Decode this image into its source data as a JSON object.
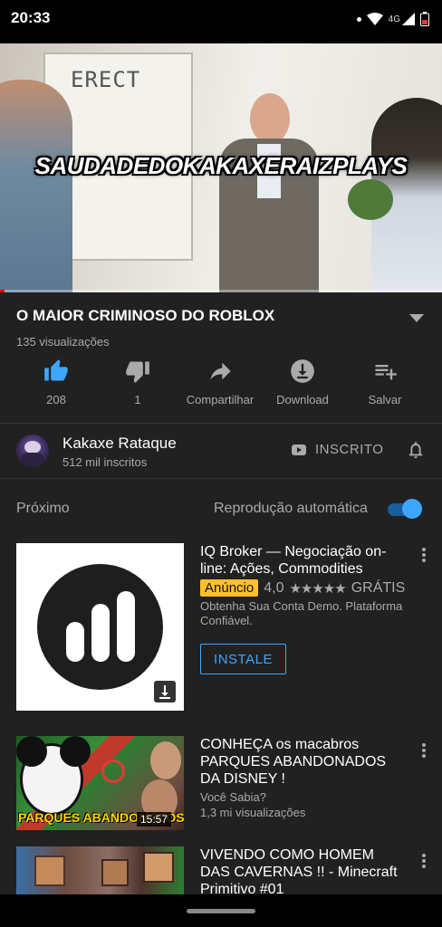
{
  "status_bar": {
    "time": "20:33",
    "network": "4G"
  },
  "player": {
    "overlay_text": "SAUDADEDOKAKAXERAIZPLAYS",
    "whiteboard_text": "ERECT",
    "progress": 0.01
  },
  "video_info": {
    "title": "O MAIOR CRIMINOSO DO ROBLOX",
    "views": "135 visualizações"
  },
  "actions": {
    "like_count": "208",
    "dislike_count": "1",
    "share_label": "Compartilhar",
    "download_label": "Download",
    "save_label": "Salvar"
  },
  "channel": {
    "name": "Kakaxe Rataque",
    "subscribers": "512 mil inscritos",
    "subscribe_state": "INSCRITO"
  },
  "up_next": {
    "label": "Próximo",
    "autoplay_label": "Reprodução automática",
    "autoplay_on": true
  },
  "ad": {
    "title": "IQ Broker — Negociação on-line: Ações, Commodities",
    "badge": "Anúncio",
    "rating": "4,0",
    "stars": "★★★★★",
    "price": "GRÁTIS",
    "description": "Obtenha Sua Conta Demo. Plataforma Confiável.",
    "cta": "INSTALE"
  },
  "videos": [
    {
      "title": "CONHEÇA os macabros PARQUES ABANDONADOS DA DISNEY !",
      "channel": "Você Sabia?",
      "views": "1,3 mi visualizações",
      "duration": "15:57",
      "thumb_caption": "PARQUES ABANDONADOS"
    },
    {
      "title": "VIVENDO COMO HOMEM DAS CAVERNAS !! - Minecraft Primitivo #01"
    }
  ],
  "colors": {
    "background": "#212121",
    "accent_blue": "#3ea6ff",
    "ad_badge": "#fbc02d",
    "progress_red": "#ff0000"
  }
}
